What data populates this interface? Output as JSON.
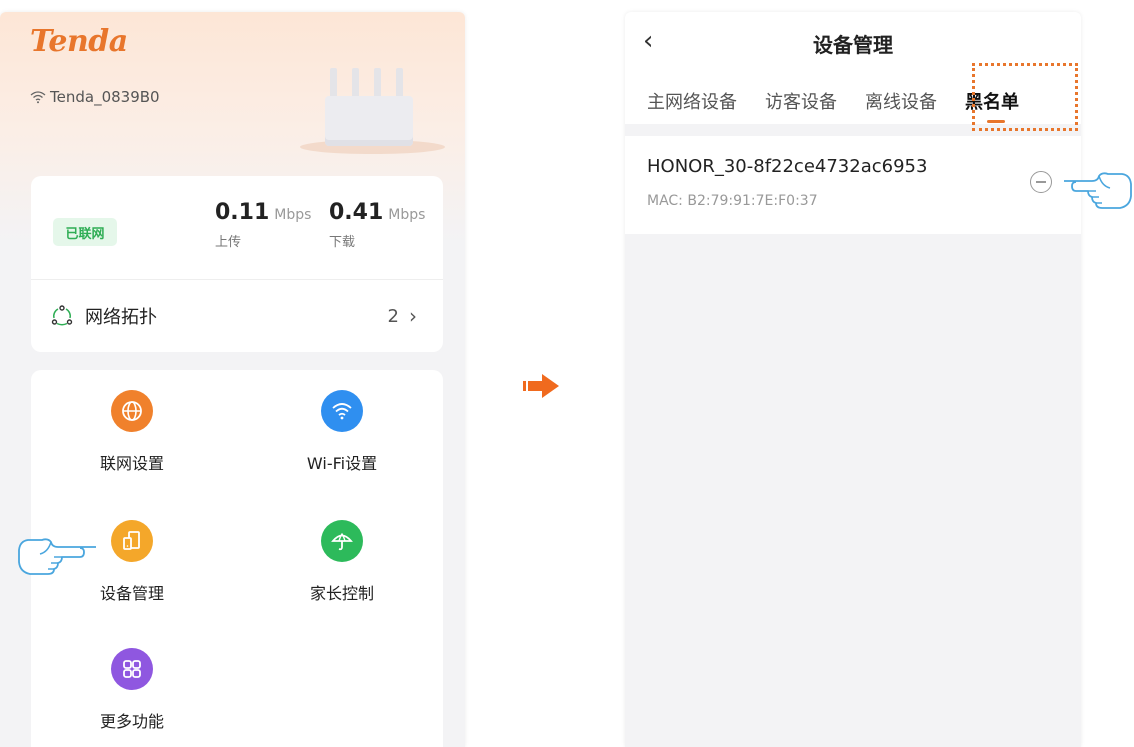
{
  "left_screen": {
    "brand": "Tenda",
    "ssid": "Tenda_0839B0",
    "status_badge": "已联网",
    "upload": {
      "value": "0.11",
      "unit": "Mbps",
      "label": "上传"
    },
    "download": {
      "value": "0.41",
      "unit": "Mbps",
      "label": "下载"
    },
    "topology": {
      "label": "网络拓扑",
      "count": "2"
    },
    "tiles": [
      {
        "label": "联网设置",
        "icon": "globe-icon",
        "color": "#f0812c"
      },
      {
        "label": "Wi-Fi设置",
        "icon": "wifi-icon",
        "color": "#2f8ff0"
      },
      {
        "label": "设备管理",
        "icon": "device-icon",
        "color": "#f4a72a"
      },
      {
        "label": "家长控制",
        "icon": "umbrella-icon",
        "color": "#2dba5b"
      },
      {
        "label": "更多功能",
        "icon": "grid-icon",
        "color": "#8f57e0"
      }
    ]
  },
  "right_screen": {
    "title": "设备管理",
    "tabs": [
      "主网络设备",
      "访客设备",
      "离线设备",
      "黑名单"
    ],
    "active_tab": "黑名单",
    "device": {
      "name": "HONOR_30-8f22ce4732ac6953",
      "mac": "MAC: B2:79:91:7E:F0:37"
    }
  },
  "colors": {
    "accent": "#e8762c",
    "online_green": "#2fae55"
  }
}
